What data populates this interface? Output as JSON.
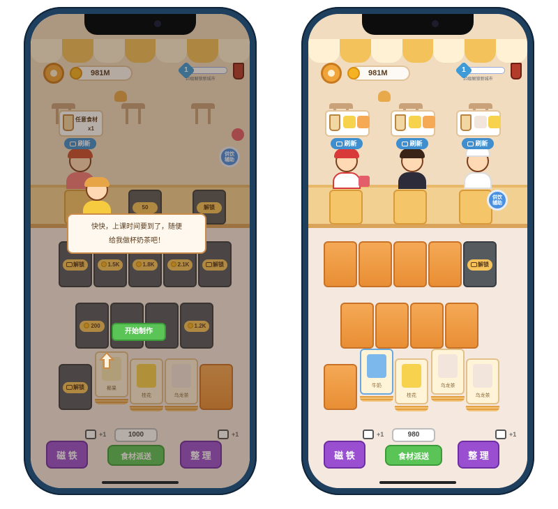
{
  "left": {
    "coins": "981M",
    "level": "1",
    "level_text": "10级解锁新城市",
    "order": {
      "title": "任意食材",
      "count": "x1",
      "refresh": "刷新"
    },
    "help": "供饮\n辅助",
    "counter_slots": [
      {
        "type": "price",
        "value": "50"
      },
      {
        "type": "unlock",
        "value": "解锁"
      }
    ],
    "row1": [
      {
        "type": "unlock",
        "value": "解锁"
      },
      {
        "type": "price",
        "value": "1.5K"
      },
      {
        "type": "price",
        "value": "1.8K"
      },
      {
        "type": "price",
        "value": "2.1K"
      },
      {
        "type": "unlock",
        "value": "解锁"
      }
    ],
    "row2": [
      {
        "type": "price",
        "value": "200"
      },
      {
        "type": "price",
        "value": "1.2K"
      }
    ],
    "row3": [
      {
        "type": "unlock",
        "value": "解锁"
      },
      {
        "type": "item",
        "name": "椰果"
      },
      {
        "type": "item",
        "name": "桂花"
      },
      {
        "type": "item",
        "name": "乌龙茶"
      }
    ],
    "dialog_line1": "快快，上课时间要到了，随便",
    "dialog_line2": "给我做杯奶茶吧！",
    "start_button": "开始制作",
    "dispatch_count": "1000",
    "dispatch_label": "食材派送",
    "magnet_label": "磁 铁",
    "sort_label": "整 理",
    "plus_one": "+1"
  },
  "right": {
    "coins": "981M",
    "level": "1",
    "level_text": "10级解锁新城市",
    "refresh": "刷新",
    "help": "供饮\n辅助",
    "row1_unlock": "解锁",
    "row3": [
      {
        "name": "牛奶"
      },
      {
        "name": "桂花"
      },
      {
        "name": "乌龙茶"
      },
      {
        "name": "乌龙茶"
      }
    ],
    "dispatch_count": "980",
    "dispatch_label": "食材派送",
    "magnet_label": "磁 铁",
    "sort_label": "整 理",
    "plus_one": "+1"
  }
}
